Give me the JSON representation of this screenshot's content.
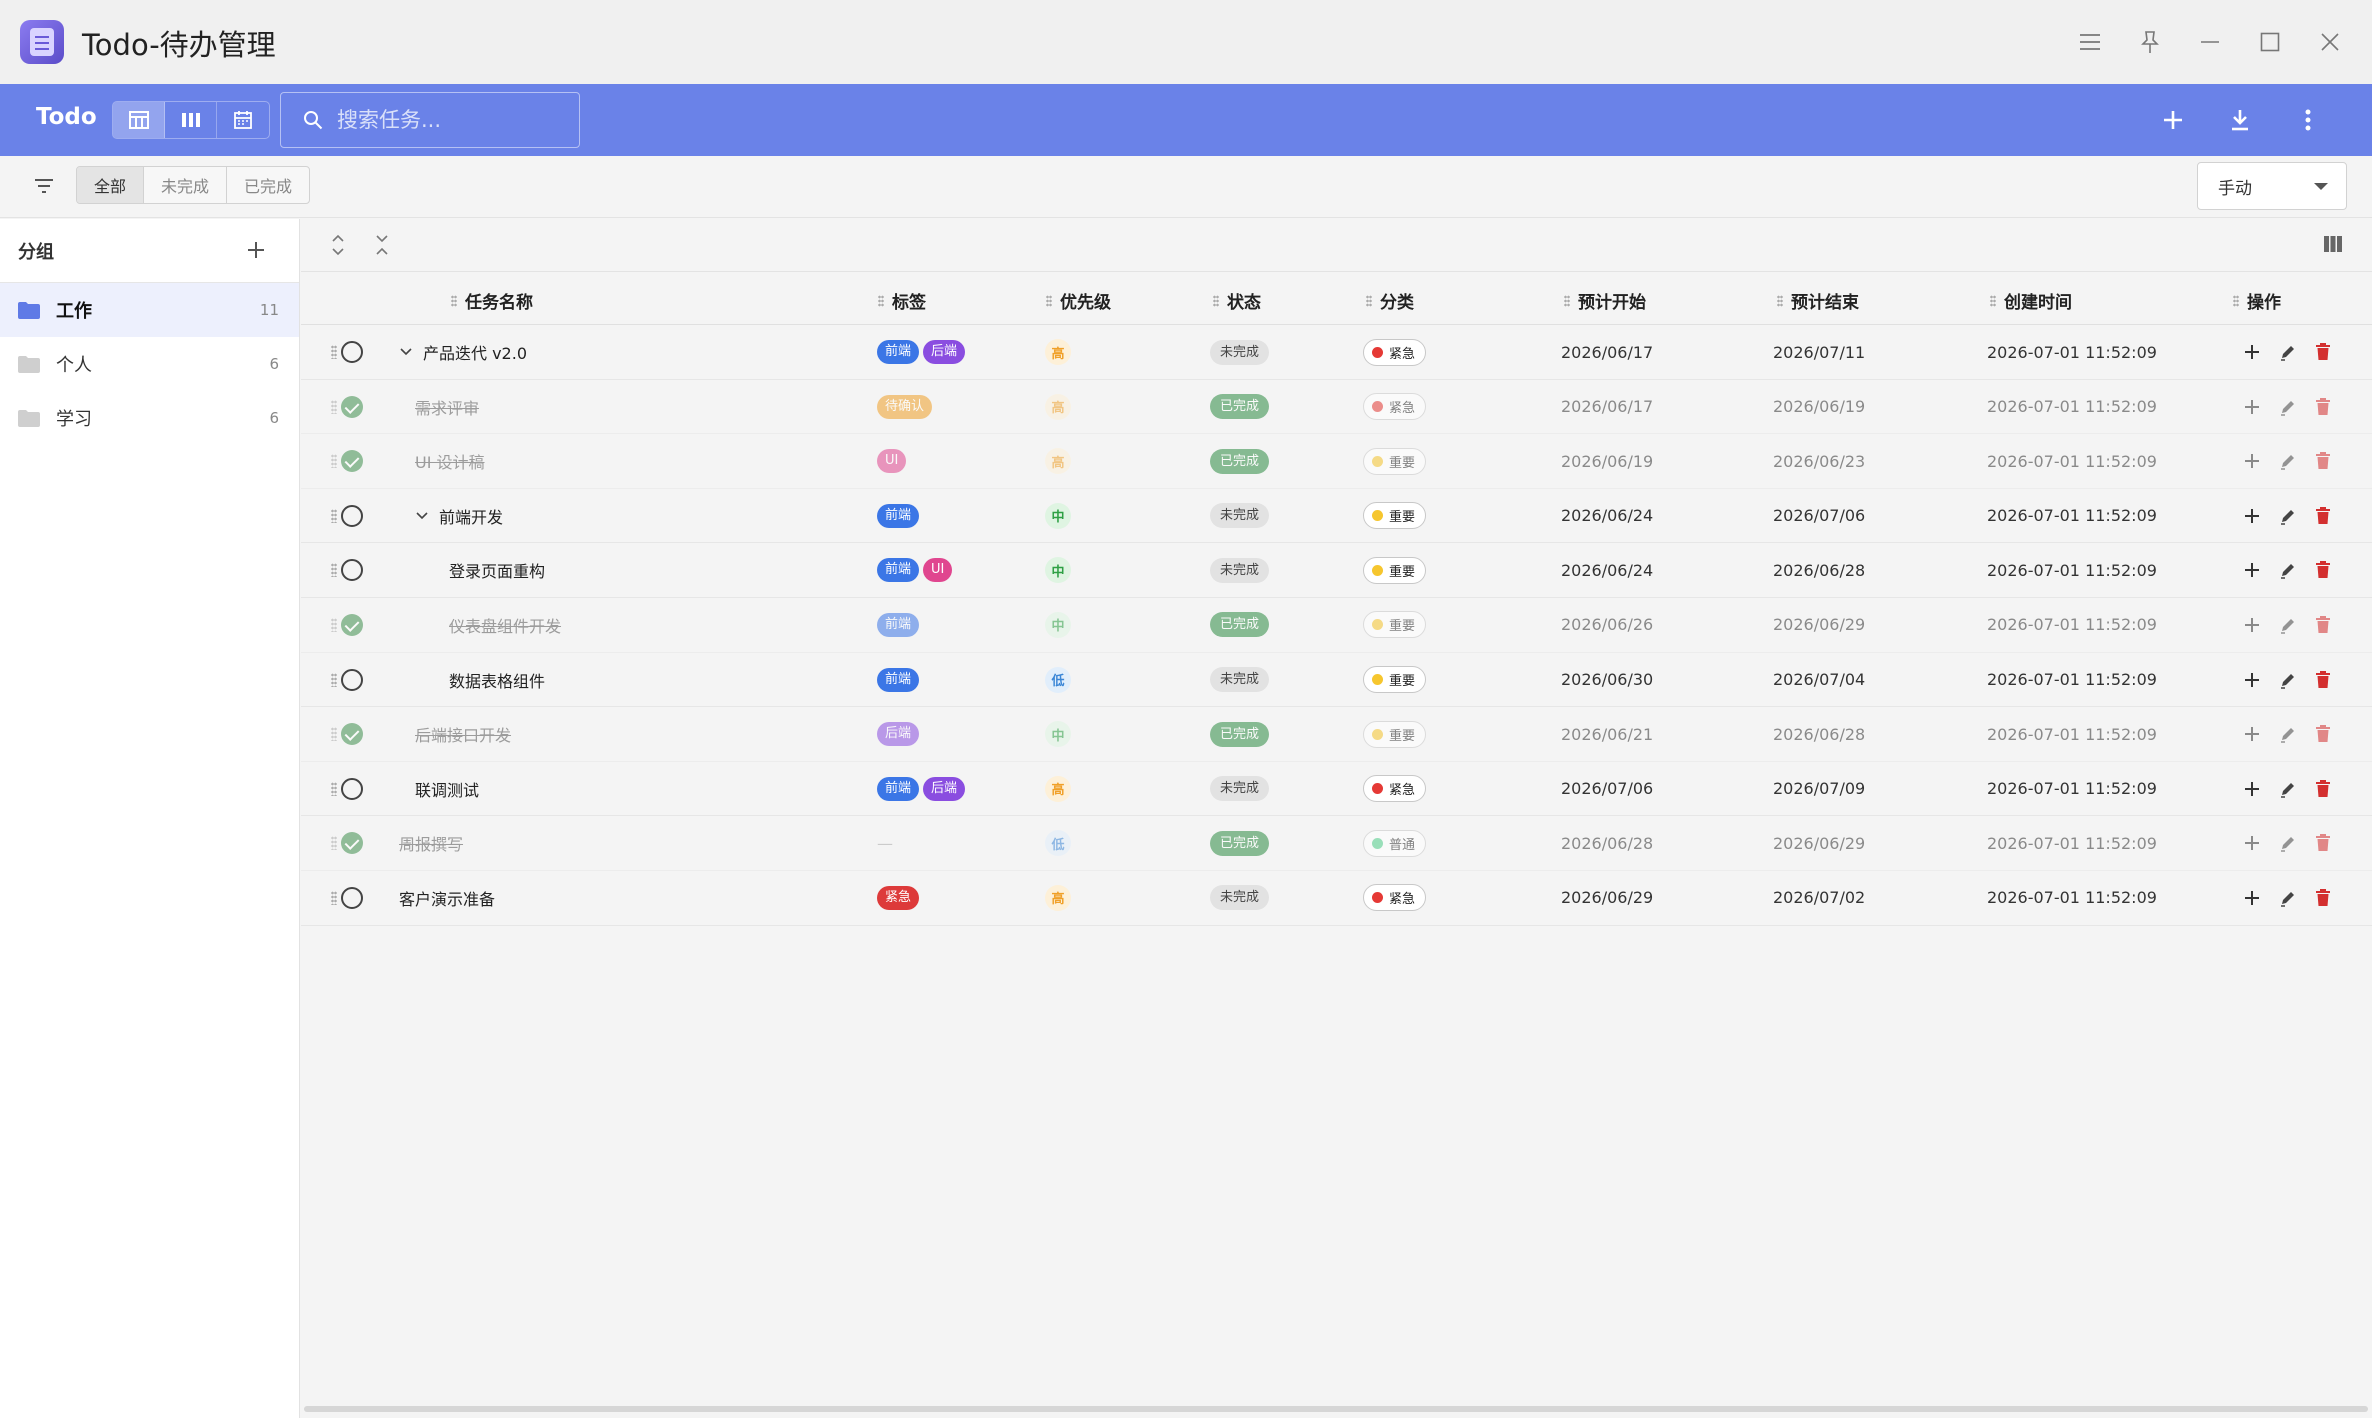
{
  "window": {
    "title": "Todo-待办管理"
  },
  "toolbar": {
    "brand": "Todo",
    "search_placeholder": "搜索任务..."
  },
  "filters": {
    "all": "全部",
    "incomplete": "未完成",
    "complete": "已完成",
    "sort_mode": "手动"
  },
  "sidebar": {
    "title": "分组",
    "groups": [
      {
        "label": "工作",
        "count": "11",
        "color": "#5f7ae6"
      },
      {
        "label": "个人",
        "count": "6",
        "color": "#cfcfcf"
      },
      {
        "label": "学习",
        "count": "6",
        "color": "#cfcfcf"
      }
    ]
  },
  "columns": {
    "name": "任务名称",
    "tags": "标签",
    "priority": "优先级",
    "status": "状态",
    "category": "分类",
    "start": "预计开始",
    "end": "预计结束",
    "created": "创建时间",
    "actions": "操作"
  },
  "colors": {
    "tag_frontend": "#3b76e6",
    "tag_backend": "#8a4de0",
    "tag_pending": "#f0a028",
    "tag_ui": "#e0468f",
    "tag_urgent": "#dd3a3a",
    "prio_high_bg": "#fdf0d8",
    "prio_high_fg": "#f0a028",
    "prio_mid_bg": "#dff4e2",
    "prio_mid_fg": "#2ea044",
    "prio_low_bg": "#e1eefb",
    "prio_low_fg": "#3b86d6",
    "cat_urgent": "#e53935",
    "cat_important": "#f6c62e",
    "cat_normal": "#4fcf8a",
    "toolbar": "#6a82e8"
  },
  "tasks": [
    {
      "name": "产品迭代 v2.0",
      "done": false,
      "indent": 1,
      "expand": true,
      "tags": [
        [
          "前端",
          "tag_frontend"
        ],
        [
          "后端",
          "tag_backend"
        ]
      ],
      "priority": "高",
      "prio": "high",
      "status": "未完成",
      "category": "紧急",
      "cat": "cat_urgent",
      "start": "2026/06/17",
      "end": "2026/07/11",
      "created": "2026-07-01 11:52:09"
    },
    {
      "name": "需求评审",
      "done": true,
      "indent": 2,
      "expand": false,
      "tags": [
        [
          "待确认",
          "tag_pending"
        ]
      ],
      "priority": "高",
      "prio": "high",
      "status": "已完成",
      "category": "紧急",
      "cat": "cat_urgent",
      "start": "2026/06/17",
      "end": "2026/06/19",
      "created": "2026-07-01 11:52:09"
    },
    {
      "name": "UI 设计稿",
      "done": true,
      "indent": 2,
      "expand": false,
      "tags": [
        [
          "UI",
          "tag_ui"
        ]
      ],
      "priority": "高",
      "prio": "high",
      "status": "已完成",
      "category": "重要",
      "cat": "cat_important",
      "start": "2026/06/19",
      "end": "2026/06/23",
      "created": "2026-07-01 11:52:09"
    },
    {
      "name": "前端开发",
      "done": false,
      "indent": 2,
      "expand": true,
      "tags": [
        [
          "前端",
          "tag_frontend"
        ]
      ],
      "priority": "中",
      "prio": "mid",
      "status": "未完成",
      "category": "重要",
      "cat": "cat_important",
      "start": "2026/06/24",
      "end": "2026/07/06",
      "created": "2026-07-01 11:52:09"
    },
    {
      "name": "登录页面重构",
      "done": false,
      "indent": 3,
      "expand": false,
      "tags": [
        [
          "前端",
          "tag_frontend"
        ],
        [
          "UI",
          "tag_ui"
        ]
      ],
      "priority": "中",
      "prio": "mid",
      "status": "未完成",
      "category": "重要",
      "cat": "cat_important",
      "start": "2026/06/24",
      "end": "2026/06/28",
      "created": "2026-07-01 11:52:09"
    },
    {
      "name": "仪表盘组件开发",
      "done": true,
      "indent": 3,
      "expand": false,
      "tags": [
        [
          "前端",
          "tag_frontend"
        ]
      ],
      "priority": "中",
      "prio": "mid",
      "status": "已完成",
      "category": "重要",
      "cat": "cat_important",
      "start": "2026/06/26",
      "end": "2026/06/29",
      "created": "2026-07-01 11:52:09"
    },
    {
      "name": "数据表格组件",
      "done": false,
      "indent": 3,
      "expand": false,
      "tags": [
        [
          "前端",
          "tag_frontend"
        ]
      ],
      "priority": "低",
      "prio": "low",
      "status": "未完成",
      "category": "重要",
      "cat": "cat_important",
      "start": "2026/06/30",
      "end": "2026/07/04",
      "created": "2026-07-01 11:52:09"
    },
    {
      "name": "后端接口开发",
      "done": true,
      "indent": 2,
      "expand": false,
      "tags": [
        [
          "后端",
          "tag_backend"
        ]
      ],
      "priority": "中",
      "prio": "mid",
      "status": "已完成",
      "category": "重要",
      "cat": "cat_important",
      "start": "2026/06/21",
      "end": "2026/06/28",
      "created": "2026-07-01 11:52:09"
    },
    {
      "name": "联调测试",
      "done": false,
      "indent": 2,
      "expand": false,
      "tags": [
        [
          "前端",
          "tag_frontend"
        ],
        [
          "后端",
          "tag_backend"
        ]
      ],
      "priority": "高",
      "prio": "high",
      "status": "未完成",
      "category": "紧急",
      "cat": "cat_urgent",
      "start": "2026/07/06",
      "end": "2026/07/09",
      "created": "2026-07-01 11:52:09"
    },
    {
      "name": "周报撰写",
      "done": true,
      "indent": 1,
      "expand": false,
      "tags": [],
      "empty_tag": "—",
      "priority": "低",
      "prio": "low",
      "status": "已完成",
      "category": "普通",
      "cat": "cat_normal",
      "start": "2026/06/28",
      "end": "2026/06/29",
      "created": "2026-07-01 11:52:09"
    },
    {
      "name": "客户演示准备",
      "done": false,
      "indent": 1,
      "expand": false,
      "tags": [
        [
          "紧急",
          "tag_urgent"
        ]
      ],
      "priority": "高",
      "prio": "high",
      "status": "未完成",
      "category": "紧急",
      "cat": "cat_urgent",
      "start": "2026/06/29",
      "end": "2026/07/02",
      "created": "2026-07-01 11:52:09"
    }
  ]
}
